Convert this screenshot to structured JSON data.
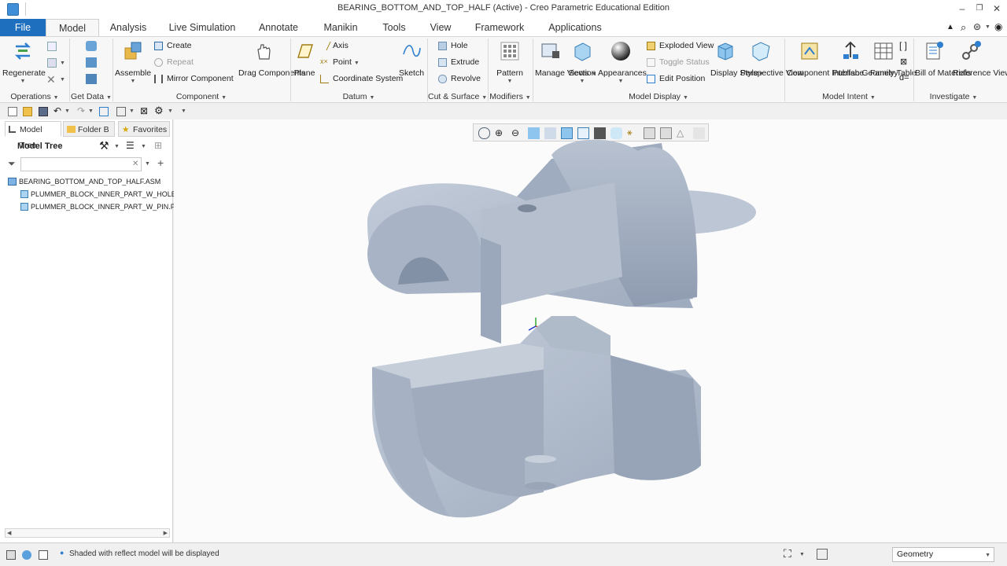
{
  "window": {
    "title": "BEARING_BOTTOM_AND_TOP_HALF (Active) - Creo Parametric Educational Edition"
  },
  "tabs": [
    "File",
    "Model",
    "Analysis",
    "Live Simulation",
    "Annotate",
    "Manikin",
    "Tools",
    "View",
    "Framework",
    "Applications"
  ],
  "active_tab": "Model",
  "ribbon": {
    "operations": {
      "group": "Operations",
      "regenerate": "Regenerate"
    },
    "get_data": {
      "group": "Get Data"
    },
    "component": {
      "group": "Component",
      "assemble": "Assemble",
      "create": "Create",
      "repeat": "Repeat",
      "mirror": "Mirror Component",
      "drag": "Drag Components"
    },
    "datum": {
      "group": "Datum",
      "plane": "Plane",
      "axis": "Axis",
      "point": "Point",
      "csys": "Coordinate System",
      "sketch": "Sketch"
    },
    "cut_surface": {
      "group": "Cut & Surface",
      "hole": "Hole",
      "extrude": "Extrude",
      "revolve": "Revolve"
    },
    "modifiers": {
      "group": "Modifiers",
      "pattern": "Pattern"
    },
    "model_display": {
      "group": "Model Display",
      "manage_views": "Manage Views",
      "section": "Section",
      "appearances": "Appearances",
      "exploded": "Exploded View",
      "toggle_status": "Toggle Status",
      "edit_position": "Edit Position",
      "display_style": "Display Style",
      "perspective": "Perspective View"
    },
    "model_intent": {
      "group": "Model Intent",
      "component_interface": "Component Interface",
      "publish_geometry": "Publish Geometry",
      "family_table": "Family Table"
    },
    "investigate": {
      "group": "Investigate",
      "bom": "Bill of Materials",
      "reference_viewer": "Reference Viewer"
    }
  },
  "panel": {
    "tabs": [
      "Model Tree",
      "Folder B",
      "Favorites"
    ],
    "header": "Model Tree",
    "filter_placeholder": "",
    "tree": [
      {
        "label": "BEARING_BOTTOM_AND_TOP_HALF.ASM",
        "level": 0
      },
      {
        "label": "PLUMMER_BLOCK_INNER_PART_W_HOLE.",
        "level": 1
      },
      {
        "label": "PLUMMER_BLOCK_INNER_PART_W_PIN.PR",
        "level": 1
      }
    ]
  },
  "status": {
    "message": "Shaded with reflect model will be displayed",
    "filter_value": "Geometry"
  },
  "colors": {
    "file_tab": "#1f6fbf",
    "model_shade": "#a9b6c8",
    "accent": "#2e7fd0"
  }
}
